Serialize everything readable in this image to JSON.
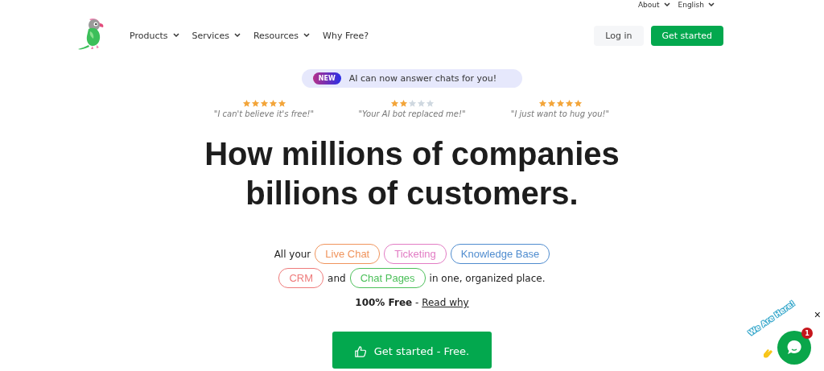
{
  "top_links": [
    {
      "label": "About"
    },
    {
      "label": "English"
    }
  ],
  "nav": {
    "items": [
      {
        "label": "Products",
        "dropdown": true
      },
      {
        "label": "Services",
        "dropdown": true
      },
      {
        "label": "Resources",
        "dropdown": true
      },
      {
        "label": "Why Free?",
        "dropdown": false
      }
    ],
    "login": "Log in",
    "cta": "Get started"
  },
  "announcement": {
    "badge": "NEW",
    "text": "AI can now answer chats for you!"
  },
  "reviews": [
    {
      "stars": 5,
      "quote": "\"I can't believe it's free!\""
    },
    {
      "stars": 2,
      "quote": "\"Your AI bot replaced me!\""
    },
    {
      "stars": 5,
      "quote": "\"I just want to hug you!\""
    }
  ],
  "headline": [
    "How millions of companies",
    "billions of customers."
  ],
  "features": {
    "lead": "All your",
    "tags": [
      {
        "label": "Live Chat",
        "color": "#f0945c"
      },
      {
        "label": "Ticketing",
        "color": "#e27cc4"
      },
      {
        "label": "Knowledge Base",
        "color": "#4f8ccf"
      },
      {
        "label": "CRM",
        "color": "#ee7b7b"
      },
      {
        "label": "Chat Pages",
        "color": "#4cc05a"
      }
    ],
    "joiner": "and",
    "tail": "in one, organized place."
  },
  "free_note": {
    "text": "100% Free",
    "separator": "-",
    "link": "Read why"
  },
  "hero_button": "Get started - Free.",
  "chat_widget": {
    "banner": "We Are Here!",
    "unread": "1",
    "close": "×"
  }
}
